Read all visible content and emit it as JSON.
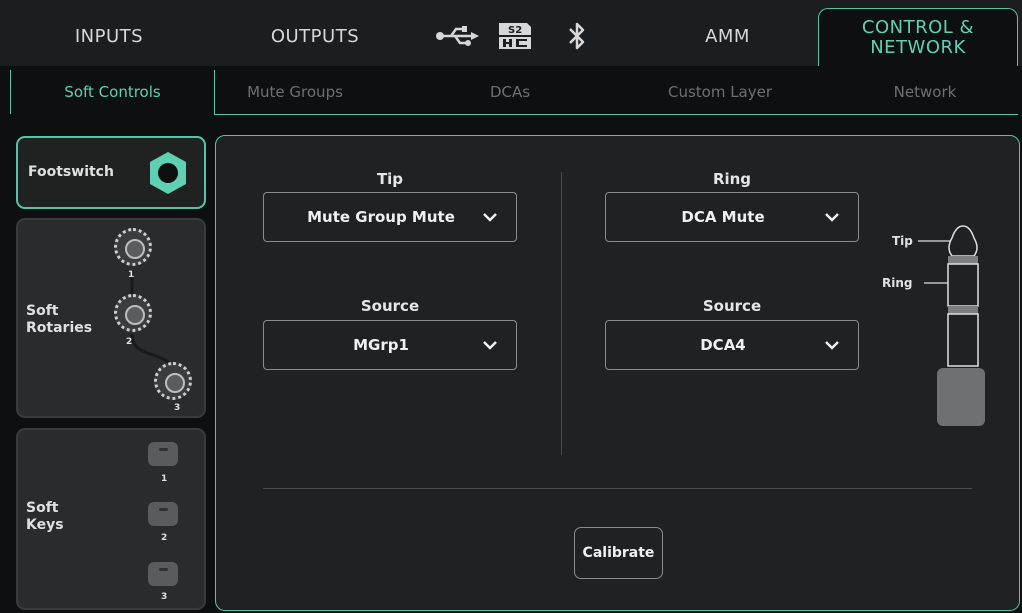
{
  "top_tabs": {
    "inputs": "INPUTS",
    "outputs": "OUTPUTS",
    "amm": "AMM",
    "control_network_line1": "CONTROL &",
    "control_network_line2": "NETWORK"
  },
  "top_icons": [
    "usb-icon",
    "sd-card-icon",
    "bluetooth-icon"
  ],
  "sub_tabs": {
    "soft_controls": "Soft Controls",
    "mute_groups": "Mute Groups",
    "dcas": "DCAs",
    "custom_layer": "Custom Layer",
    "network": "Network"
  },
  "side_panel": {
    "footswitch": "Footswitch",
    "soft_rotaries_line1": "Soft",
    "soft_rotaries_line2": "Rotaries",
    "rotary_numbers": [
      "1",
      "2",
      "3"
    ],
    "soft_keys_line1": "Soft",
    "soft_keys_line2": "Keys",
    "key_numbers": [
      "1",
      "2",
      "3"
    ]
  },
  "tip": {
    "label": "Tip",
    "function_value": "Mute Group Mute",
    "source_label": "Source",
    "source_value": "MGrp1"
  },
  "ring": {
    "label": "Ring",
    "function_value": "DCA Mute",
    "source_label": "Source",
    "source_value": "DCA4"
  },
  "jack_diagram": {
    "tip_label": "Tip",
    "ring_label": "Ring"
  },
  "calibrate_label": "Calibrate",
  "colors": {
    "accent": "#58c3a7",
    "background": "#0e0f10",
    "panel": "#1f2122"
  }
}
